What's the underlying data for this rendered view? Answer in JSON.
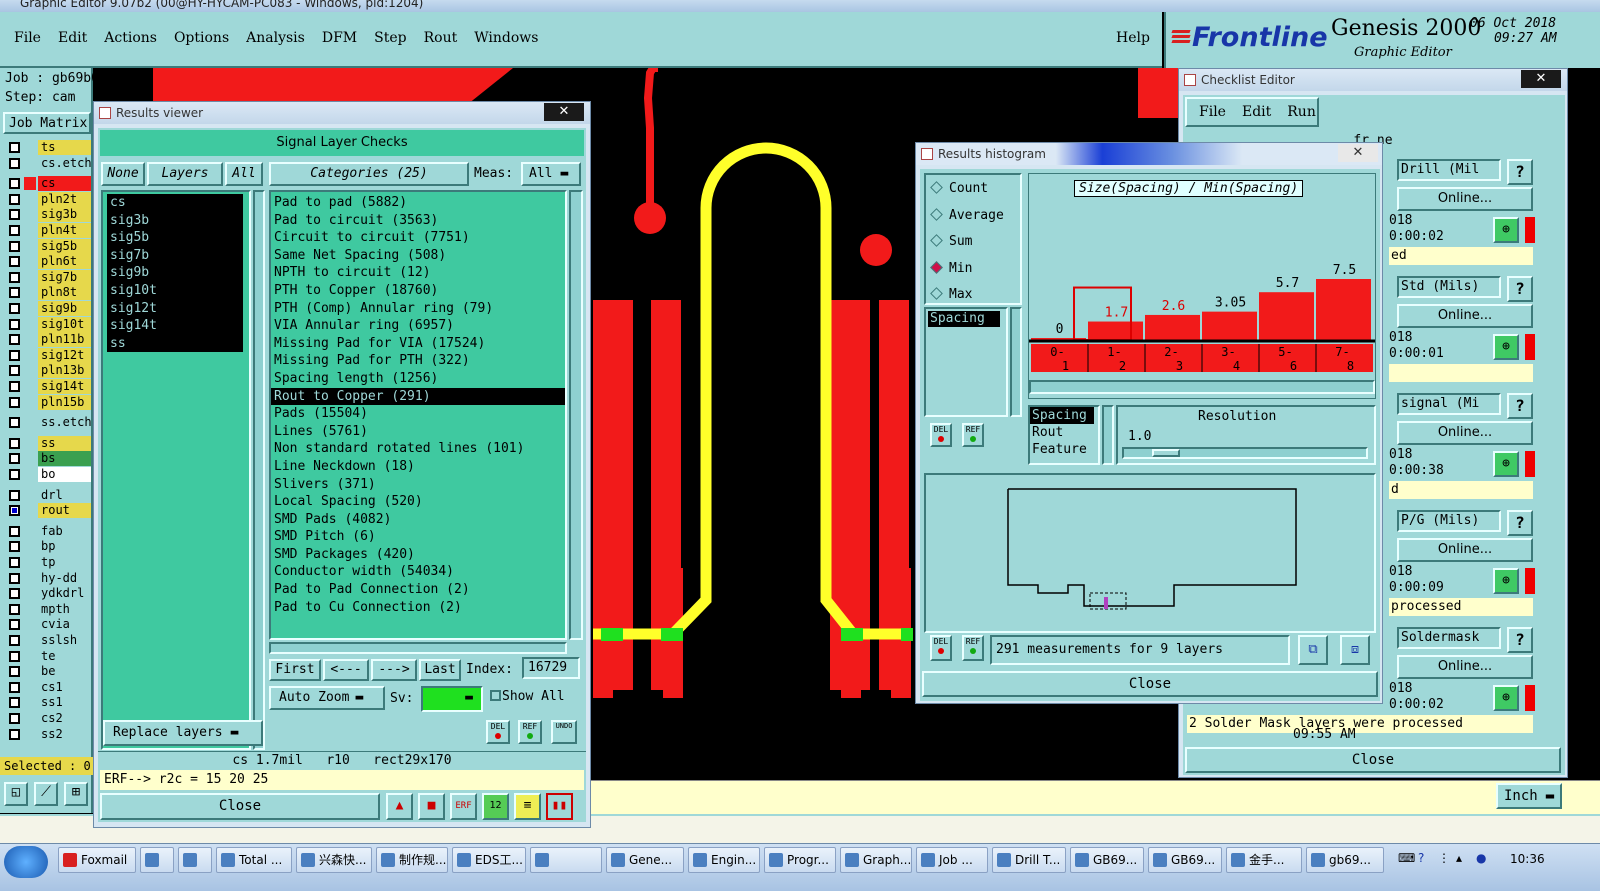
{
  "app": {
    "title": "Graphic Editor 9.07b2 (00@HY-HYCAM-PC083 - Windows, pid:1204)",
    "menu": [
      "File",
      "Edit",
      "Actions",
      "Options",
      "Analysis",
      "DFM",
      "Step",
      "Rout",
      "Windows"
    ],
    "help": "Help",
    "brand_logo": "Frontline",
    "brand_product": "Genesis 2000",
    "brand_sub": "Graphic Editor",
    "date": "06 Oct 2018",
    "time": "09:27 AM",
    "job_label": "Job : gb69b005a0",
    "step_label": "Step: cam",
    "job_matrix": "Job Matrix",
    "layers": [
      {
        "name": "ts",
        "color": "#e6d84b"
      },
      {
        "name": "cs.etch",
        "color": "#9fd8d8"
      },
      {
        "name": "cs",
        "color": "#f21a1a"
      },
      {
        "name": "pln2t",
        "color": "#e6d84b"
      },
      {
        "name": "sig3b",
        "color": "#e6d84b"
      },
      {
        "name": "pln4t",
        "color": "#e6d84b"
      },
      {
        "name": "sig5b",
        "color": "#e6d84b"
      },
      {
        "name": "pln6t",
        "color": "#e6d84b"
      },
      {
        "name": "sig7b",
        "color": "#e6d84b"
      },
      {
        "name": "pln8t",
        "color": "#e6d84b"
      },
      {
        "name": "sig9b",
        "color": "#e6d84b"
      },
      {
        "name": "sig10t",
        "color": "#e6d84b"
      },
      {
        "name": "pln11b",
        "color": "#e6d84b"
      },
      {
        "name": "sig12t",
        "color": "#e6d84b"
      },
      {
        "name": "pln13b",
        "color": "#e6d84b"
      },
      {
        "name": "sig14t",
        "color": "#e6d84b"
      },
      {
        "name": "pln15b",
        "color": "#e6d84b"
      },
      {
        "name": "ss.etch",
        "color": "#9fd8d8"
      },
      {
        "name": "ss",
        "color": "#e6d84b"
      },
      {
        "name": "bs",
        "color": "#3aa050"
      },
      {
        "name": "bo",
        "color": "#ffffff"
      },
      {
        "name": "drl",
        "color": "#9fd8d8"
      },
      {
        "name": "rout",
        "color": "#e6d84b"
      },
      {
        "name": "fab",
        "color": "#9fd8d8"
      },
      {
        "name": "bp",
        "color": "#9fd8d8"
      },
      {
        "name": "tp",
        "color": "#9fd8d8"
      },
      {
        "name": "hy-dd",
        "color": "#9fd8d8"
      },
      {
        "name": "ydkdrl",
        "color": "#9fd8d8"
      },
      {
        "name": "mpth",
        "color": "#9fd8d8"
      },
      {
        "name": "cvia",
        "color": "#9fd8d8"
      },
      {
        "name": "sslsh",
        "color": "#9fd8d8"
      },
      {
        "name": "te",
        "color": "#9fd8d8"
      },
      {
        "name": "be",
        "color": "#9fd8d8"
      },
      {
        "name": "cs1",
        "color": "#9fd8d8"
      },
      {
        "name": "ss1",
        "color": "#9fd8d8"
      },
      {
        "name": "cs2",
        "color": "#9fd8d8"
      },
      {
        "name": "ss2",
        "color": "#9fd8d8"
      }
    ],
    "selected": "Selected : 0",
    "units": "Inch"
  },
  "results_viewer": {
    "title": "Results viewer",
    "header": "Signal Layer Checks",
    "none": "None",
    "layers_btn": "Layers",
    "all": "All",
    "categories_btn": "Categories (25)",
    "meas_label": "Meas:",
    "meas_value": "All",
    "layer_list": [
      "cs",
      "sig3b",
      "sig5b",
      "sig7b",
      "sig9b",
      "sig10t",
      "sig12t",
      "sig14t",
      "ss"
    ],
    "categories": [
      "Pad to pad (5882)",
      "Pad to circuit (3563)",
      "Circuit to circuit (7751)",
      "Same Net Spacing (508)",
      "NPTH to circuit (12)",
      "PTH to Copper (18760)",
      "PTH (Comp) Annular ring (79)",
      "VIA Annular ring (6957)",
      "Missing Pad for VIA (17524)",
      "Missing Pad for PTH (322)",
      "Spacing length (1256)",
      "Rout to Copper (291)",
      "Pads (15504)",
      "Lines (5761)",
      "Non standard rotated lines (101)",
      "Line Neckdown (18)",
      "Slivers (371)",
      "Local Spacing (520)",
      "SMD Pads (4082)",
      "SMD Pitch (6)",
      "SMD Packages (420)",
      "Conductor width (54034)",
      "Pad to Pad Connection (2)",
      "Pad to Cu Connection (2)"
    ],
    "selected_category": "Rout to Copper (291)",
    "first": "First",
    "prev": "<---",
    "next": "--->",
    "last": "Last",
    "index_label": "Index:",
    "index_value": "16729",
    "auto_zoom": "Auto Zoom",
    "sv_label": "Sv:",
    "show_all": "Show All",
    "replace_layers": "Replace layers",
    "del": "DEL",
    "ref": "REF",
    "undo": "UNDO",
    "info": "cs 1.7mil   r10   rect29x170",
    "erf": "ERF--> r2c = 15 20 25",
    "close": "Close"
  },
  "histogram": {
    "title": "Results histogram",
    "stat_options": [
      "Count",
      "Average",
      "Sum",
      "Min",
      "Max"
    ],
    "stat_selected": "Min",
    "category_list": [
      "Spacing"
    ],
    "chart_title": "Size(Spacing) / Min(Spacing)",
    "chart_data": {
      "type": "bar",
      "title": "Size(Spacing) / Min(Spacing)",
      "categories": [
        "0-1",
        "1-2",
        "2-3",
        "3-4",
        "5-6",
        "7-8"
      ],
      "values": [
        0,
        1.7,
        2.6,
        3.05,
        5.7,
        7.5
      ],
      "value_labels": [
        "0",
        "1.7",
        "2.6",
        "3.05",
        "5.7",
        "7.5"
      ],
      "highlighted": "1-2",
      "bar_color": "#f21a1a"
    },
    "bin_labels": [
      [
        "0-",
        "1"
      ],
      [
        "1-",
        "2"
      ],
      [
        "2-",
        "3"
      ],
      [
        "3-",
        "4"
      ],
      [
        "5-",
        "6"
      ],
      [
        "7-",
        "8"
      ]
    ],
    "field_list": [
      "Spacing",
      "Rout",
      "Feature"
    ],
    "resolution_label": "Resolution",
    "resolution_value": "1.0",
    "del": "DEL",
    "ref": "REF",
    "measurements": "291 measurements for 9 layers",
    "close": "Close"
  },
  "checklist": {
    "title": "Checklist Editor",
    "menu": [
      "File",
      "Edit",
      "Run"
    ],
    "header_partial": "fr.ne",
    "online": "Online...",
    "entries": [
      {
        "name": "Drill (Mil",
        "date": "018",
        "time": "0:00:02",
        "status": "ed"
      },
      {
        "name": "Std (Mils)",
        "date": "018",
        "time": "0:00:01",
        "status": ""
      },
      {
        "name": "signal (Mi",
        "date": "018",
        "time": "0:00:38",
        "status": "d"
      },
      {
        "name": "P/G (Mils)",
        "date": "018",
        "time": "0:00:09",
        "status": "processed"
      },
      {
        "name": "Soldermask",
        "date": "018",
        "time": "0:00:02",
        "status": "2 Solder Mask layers were processed"
      }
    ],
    "partial_time": "09:55 AM",
    "close": "Close"
  },
  "taskbar": {
    "items": [
      "Foxmail",
      "",
      "",
      "Total ...",
      "兴森快...",
      "制作规...",
      "EDS工...",
      "",
      "Gene...",
      "Engin...",
      "Progr...",
      "Graph...",
      "Job ...",
      "Drill T...",
      "GB69...",
      "GB69...",
      "金手...",
      "gb69..."
    ],
    "clock": "10:36"
  }
}
